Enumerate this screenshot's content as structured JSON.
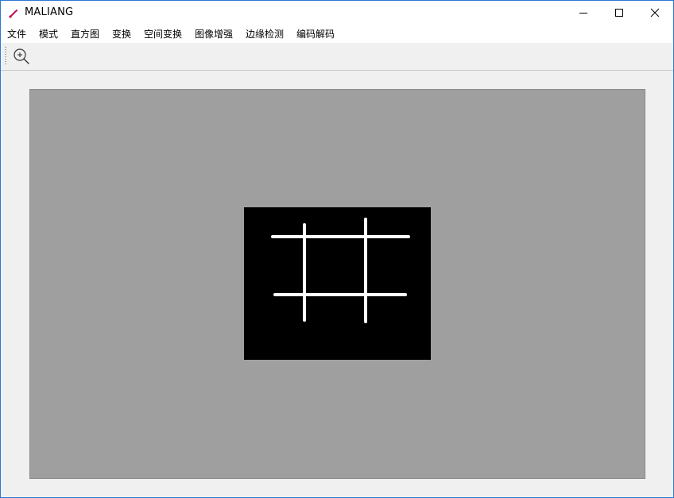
{
  "window": {
    "title": "MALIANG"
  },
  "menubar": {
    "items": [
      {
        "label": "文件"
      },
      {
        "label": "模式"
      },
      {
        "label": "直方图"
      },
      {
        "label": "变换"
      },
      {
        "label": "空间变换"
      },
      {
        "label": "图像增强"
      },
      {
        "label": "边缘检测"
      },
      {
        "label": "编码解码"
      }
    ]
  },
  "toolbar": {
    "zoom_icon": "zoom-in-icon"
  },
  "canvas": {
    "background": "#9f9f9f",
    "image_background": "#000000",
    "line_color": "#ffffff"
  },
  "icons": {
    "app": "brush-icon",
    "minimize": "minimize-icon",
    "maximize": "maximize-icon",
    "close": "close-icon"
  }
}
